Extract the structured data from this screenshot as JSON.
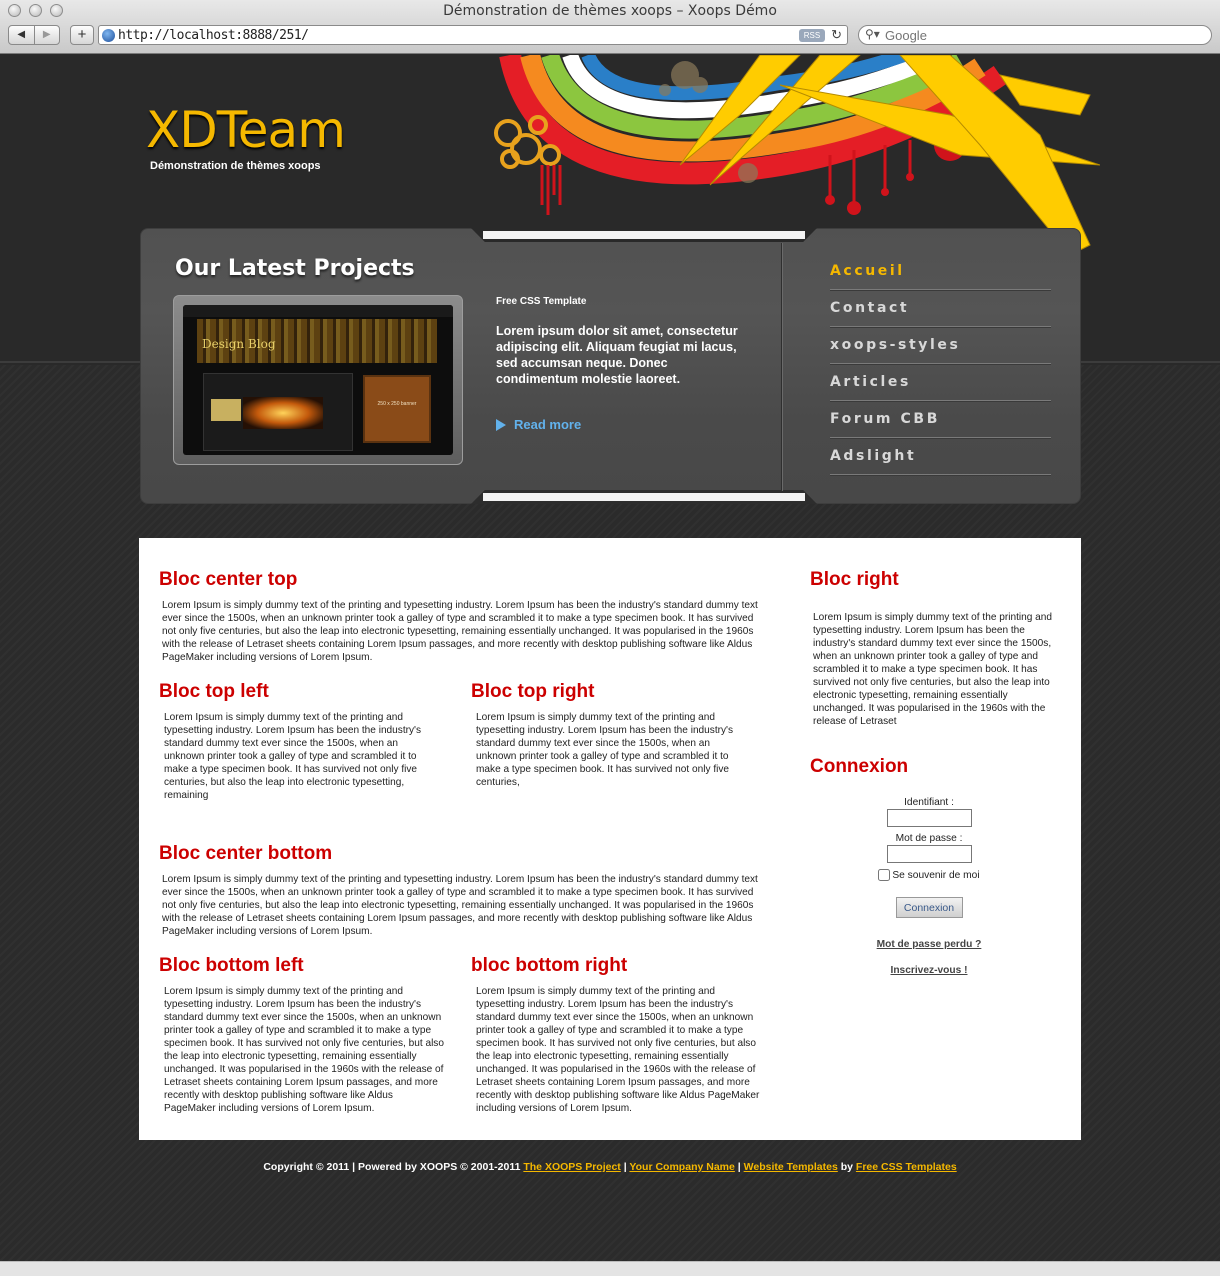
{
  "browser": {
    "window_title": "Démonstration de thèmes xoops – Xoops Démo",
    "back": "◀",
    "forward": "▶",
    "add": "+",
    "url": "http://localhost:8888/251/",
    "rss": "RSS",
    "reload": "↻",
    "search_placeholder": "Google"
  },
  "site": {
    "logo": "XDTeam",
    "slogan": "Démonstration de thèmes xoops"
  },
  "featured": {
    "title": "Our Latest Projects",
    "thumb_caption": "Design Blog",
    "thumb_banner": "250 x 250 banner",
    "kicker": "Free CSS Template",
    "text": "Lorem ipsum dolor sit amet, consectetur adipiscing elit. Aliquam feugiat mi lacus, sed accumsan neque. Donec condimentum molestie laoreet.",
    "read_more": "Read more"
  },
  "menu": [
    "Accueil",
    "Contact",
    "xoops-styles",
    "Articles",
    "Forum CBB",
    "Adslight"
  ],
  "blocks": {
    "center_top": {
      "title": "Bloc center top",
      "text": "Lorem Ipsum is simply dummy text of the printing and typesetting industry. Lorem Ipsum has been the industry's standard dummy text ever since the 1500s, when an unknown printer took a galley of type and scrambled it to make a type specimen book. It has survived not only five centuries, but also the leap into electronic typesetting, remaining essentially unchanged. It was popularised in the 1960s with the release of Letraset sheets containing Lorem Ipsum passages, and more recently with desktop publishing software like Aldus PageMaker including versions of Lorem Ipsum."
    },
    "top_left": {
      "title": "Bloc top left",
      "text": "Lorem Ipsum is simply dummy text of the printing and typesetting industry. Lorem Ipsum has been the industry's standard dummy text ever since the 1500s, when an unknown printer took a galley of type and scrambled it to make a type specimen book. It has survived not only five centuries, but also the leap into electronic typesetting, remaining"
    },
    "top_right": {
      "title": "Bloc top right",
      "text": "Lorem Ipsum is simply dummy text of the printing and typesetting industry. Lorem Ipsum has been the industry's standard dummy text ever since the 1500s, when an unknown printer took a galley of type and scrambled it to make a type specimen book. It has survived not only five centuries,"
    },
    "center_bottom": {
      "title": "Bloc center bottom",
      "text": "Lorem Ipsum is simply dummy text of the printing and typesetting industry. Lorem Ipsum has been the industry's standard dummy text ever since the 1500s, when an unknown printer took a galley of type and scrambled it to make a type specimen book. It has survived not only five centuries, but also the leap into electronic typesetting, remaining essentially unchanged. It was popularised in the 1960s with the release of Letraset sheets containing Lorem Ipsum passages, and more recently with desktop publishing software like Aldus PageMaker including versions of Lorem Ipsum."
    },
    "bottom_left": {
      "title": "Bloc bottom left",
      "text": "Lorem Ipsum is simply dummy text of the printing and typesetting industry. Lorem Ipsum has been the industry's standard dummy text ever since the 1500s, when an unknown printer took a galley of type and scrambled it to make a type specimen book. It has survived not only five centuries, but also the leap into electronic typesetting, remaining essentially unchanged. It was popularised in the 1960s with the release of Letraset sheets containing Lorem Ipsum passages, and more recently with desktop publishing software like Aldus PageMaker including versions of Lorem Ipsum."
    },
    "bottom_right": {
      "title": "bloc bottom right",
      "text": "Lorem Ipsum is simply dummy text of the printing and typesetting industry. Lorem Ipsum has been the industry's standard dummy text ever since the 1500s, when an unknown printer took a galley of type and scrambled it to make a type specimen book. It has survived not only five centuries, but also the leap into electronic typesetting, remaining essentially unchanged. It was popularised in the 1960s with the release of Letraset sheets containing Lorem Ipsum passages, and more recently with desktop publishing software like Aldus PageMaker including versions of Lorem Ipsum."
    },
    "right": {
      "title": "Bloc right",
      "text": "Lorem Ipsum is simply dummy text of the printing and typesetting industry. Lorem Ipsum has been the industry's standard dummy text ever since the 1500s, when an unknown printer took a galley of type and scrambled it to make a type specimen book. It has survived not only five centuries, but also the leap into electronic typesetting, remaining essentially unchanged. It was popularised in the 1960s with the release of Letraset"
    }
  },
  "login": {
    "title": "Connexion",
    "username_label": "Identifiant :",
    "password_label": "Mot de passe :",
    "remember": "Se souvenir de moi",
    "submit": "Connexion",
    "lost_password": "Mot de passe perdu ?",
    "register": "Inscrivez-vous !"
  },
  "footer": {
    "copyright": "Copyright © 2011 | Powered by XOOPS © 2001-2011",
    "xoops_project": "The XOOPS Project",
    "sep": "|",
    "company": "Your Company Name",
    "website_templates": "Website Templates",
    "by": "by",
    "free_css": "Free CSS Templates"
  },
  "colors": {
    "accent_yellow": "#f5b800",
    "title_red": "#cc0000",
    "link_blue": "#62b2ec"
  }
}
